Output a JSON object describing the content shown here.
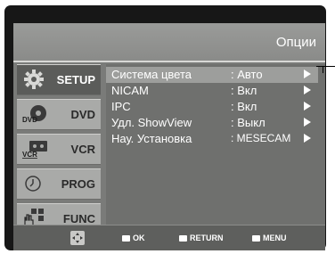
{
  "header": {
    "title": "Опции"
  },
  "tabs": [
    {
      "label": "SETUP",
      "icon": "gear-icon",
      "active": true
    },
    {
      "label": "DVD",
      "icon": "dvd-disc-icon",
      "icon_text": "DVD",
      "active": false
    },
    {
      "label": "VCR",
      "icon": "vcr-cassette-icon",
      "icon_text": "VCR",
      "active": false
    },
    {
      "label": "PROG",
      "icon": "clock-icon",
      "active": false
    },
    {
      "label": "FUNC",
      "icon": "hand-icon",
      "active": false
    }
  ],
  "menu": {
    "items": [
      {
        "label": "Система цвета",
        "value": ": Авто",
        "selected": true
      },
      {
        "label": "NICAM",
        "value": ": Вкл",
        "selected": false
      },
      {
        "label": "IPC",
        "value": ": Вкл",
        "selected": false
      },
      {
        "label": "Удл. ShowView",
        "value": ": Выкл",
        "selected": false
      },
      {
        "label": "Нау. Установка",
        "value": ": MESECAM",
        "selected": false
      }
    ]
  },
  "footer": {
    "nav_icon": "navigation-pad-icon",
    "ok_label": "OK",
    "return_label": "RETURN",
    "menu_label": "MENU"
  },
  "colors": {
    "frame": "#171717",
    "screen": "#7a7b79",
    "header": "#8a8b89",
    "active_tab": "#5b5c5a",
    "inactive_tab": "#a9aaa8",
    "selected_row": "#9d9e9c",
    "footer": "#5e5f5d"
  }
}
